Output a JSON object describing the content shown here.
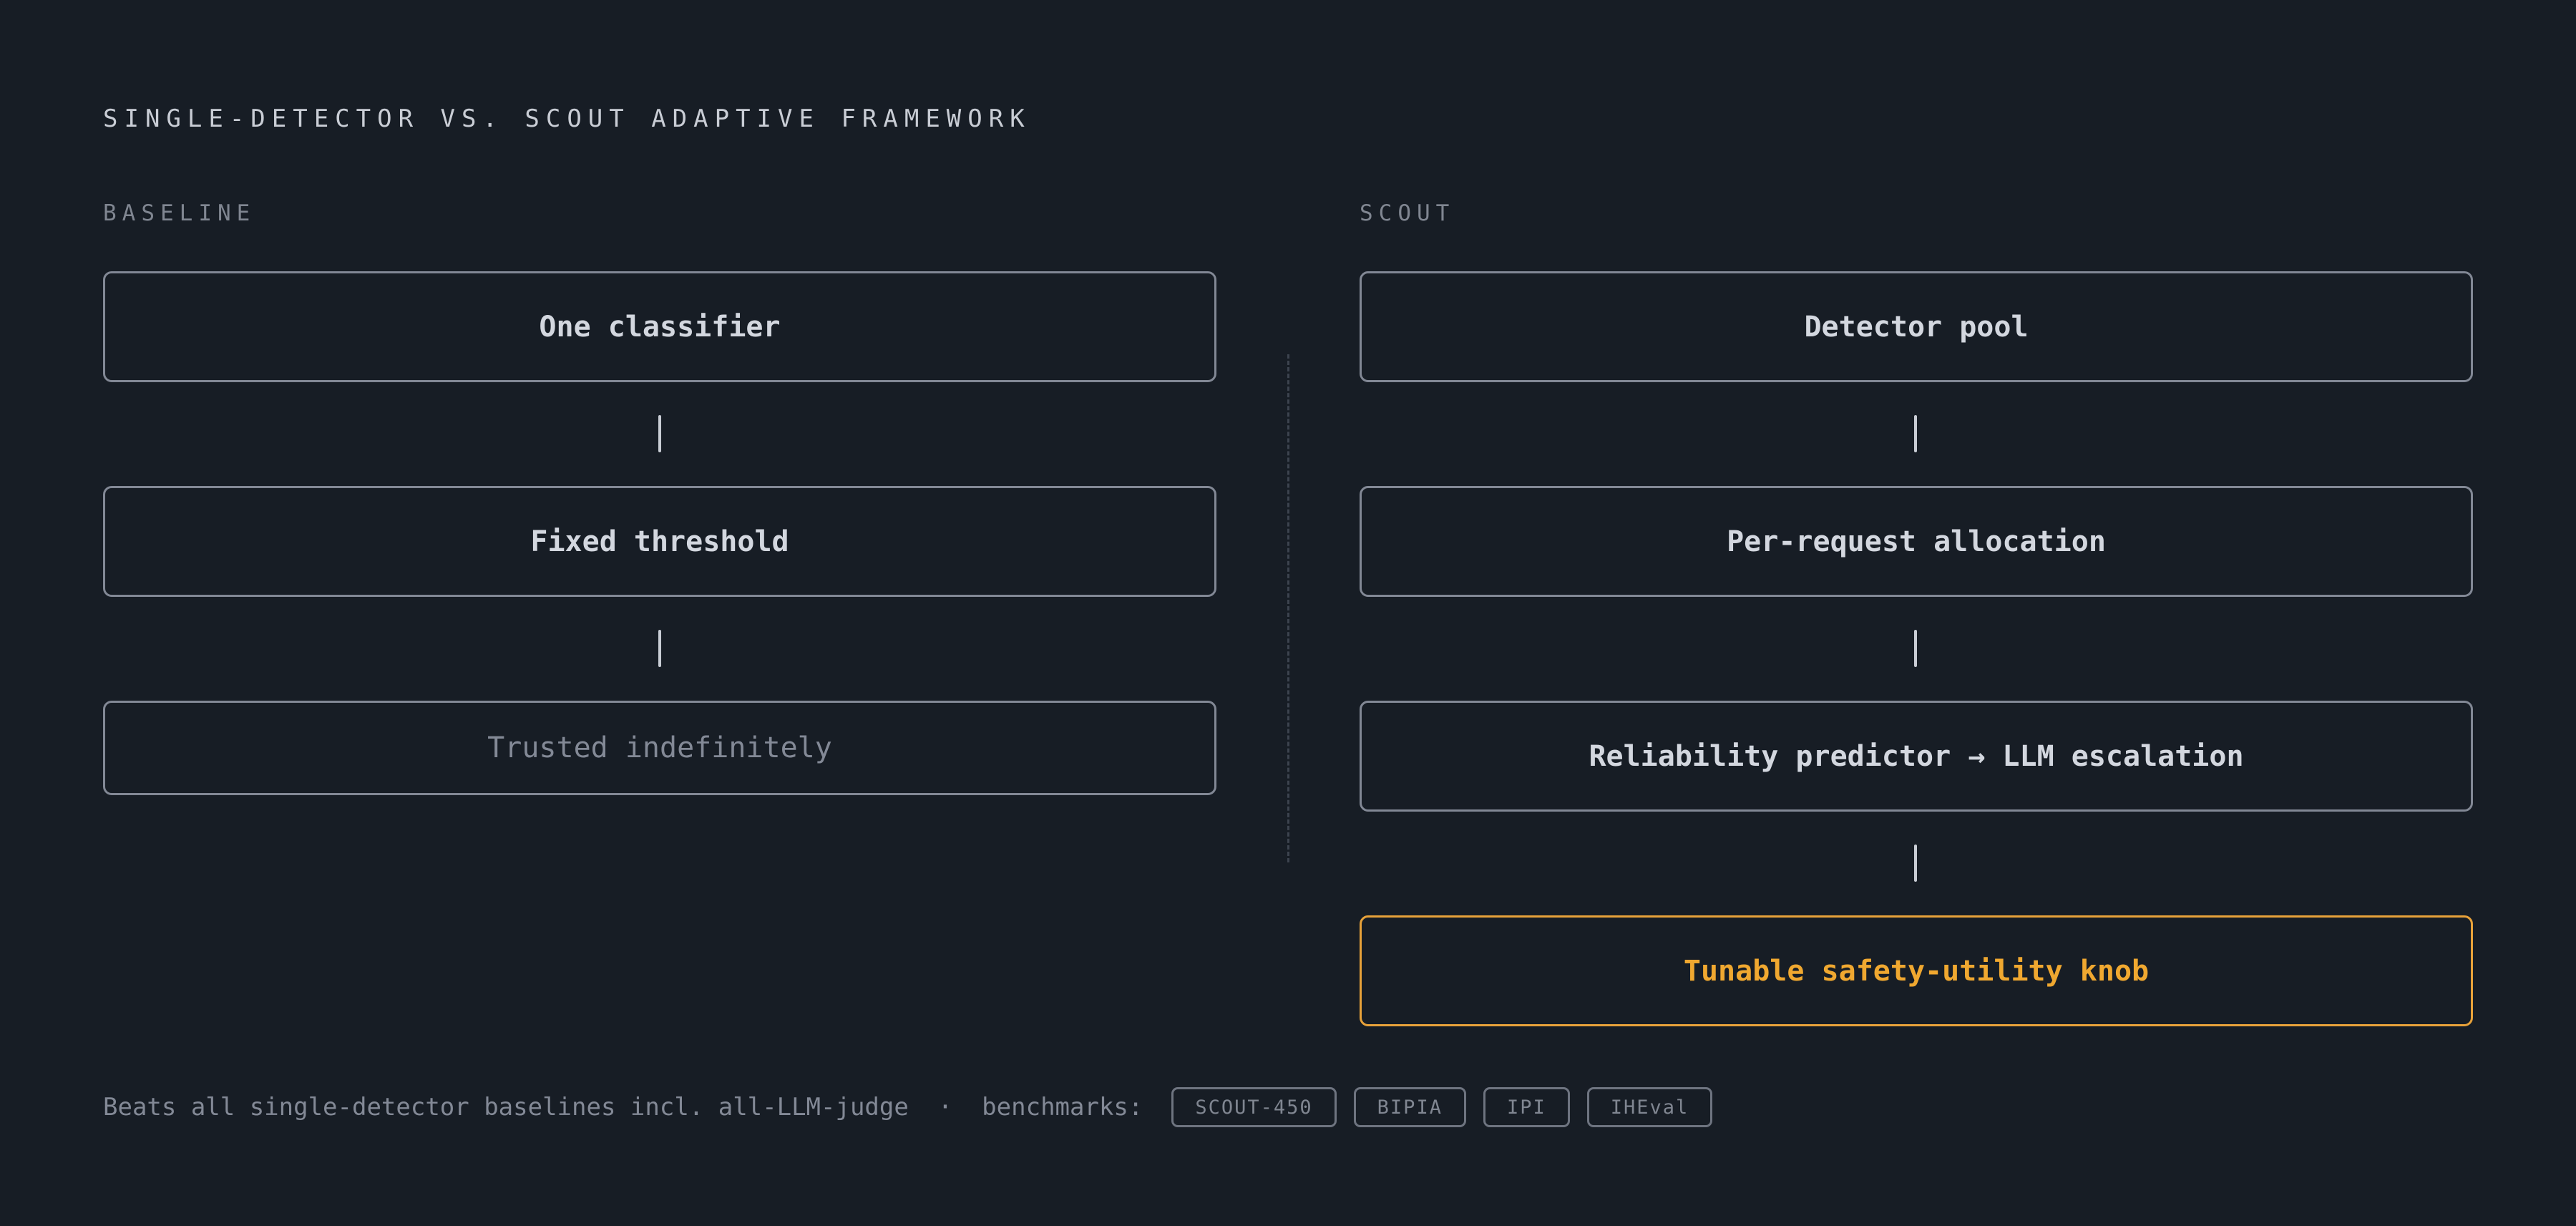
{
  "title": "SINGLE-DETECTOR VS. SCOUT ADAPTIVE FRAMEWORK",
  "baseline": {
    "label": "BASELINE",
    "steps": [
      "One classifier",
      "Fixed threshold",
      "Trusted indefinitely"
    ]
  },
  "scout": {
    "label": "SCOUT",
    "steps": [
      "Detector pool",
      "Per-request allocation",
      "Reliability predictor → LLM escalation",
      "Tunable safety-utility knob"
    ]
  },
  "footer": {
    "text": "Beats all single-detector baselines incl. all-LLM-judge  ·  benchmarks:",
    "benchmarks": [
      "SCOUT-450",
      "BIPIA",
      "IPI",
      "IHEval"
    ]
  },
  "colors": {
    "background": "#171d25",
    "box_border": "#828895",
    "accent": "#f0a830",
    "muted_text": "#838996"
  }
}
